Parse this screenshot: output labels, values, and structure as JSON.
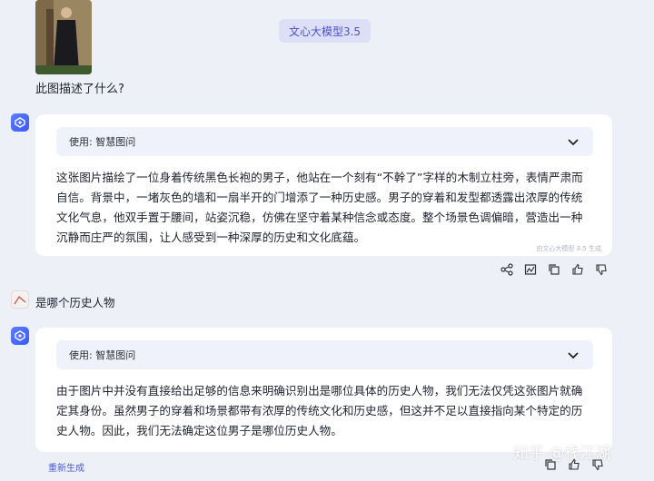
{
  "header": {
    "model_badge": "文心大模型3.5"
  },
  "conversation": {
    "q1": "此图描述了什么?",
    "a1": {
      "tool_label": "使用: 智慧图问",
      "text": "这张图片描绘了一位身着传统黑色长袍的男子，他站在一个刻有“不幹了”字样的木制立柱旁，表情严肃而自信。背景中，一堵灰色的墙和一扇半开的门增添了一种历史感。男子的穿着和发型都透露出浓厚的传统文化气息，他双手置于腰间，站姿沉稳，仿佛在坚守着某种信念或态度。整个场景色调偏暗，营造出一种沉静而庄严的氛围，让人感受到一种深厚的历史和文化底蕴。",
      "gen_note": "由文心大模型 3.5 生成"
    },
    "q2": "是哪个历史人物",
    "a2": {
      "tool_label": "使用: 智慧图问",
      "text": "由于图片中并没有直接给出足够的信息来明确识别出是哪位具体的历史人物，我们无法仅凭这张图片就确定其身份。虽然男子的穿着和场景都带有浓厚的传统文化和历史感，但这并不足以直接指向某个特定的历史人物。因此，我们无法确定这位男子是哪位历史人物。"
    }
  },
  "footer": {
    "regenerate": "重新生成",
    "watermark": "知乎 @栈江湖"
  },
  "icons": [
    "share-icon",
    "chart-icon",
    "copy-icon",
    "thumbs-up-icon",
    "thumbs-down-icon",
    "chevron-down-icon"
  ],
  "colors": {
    "accent": "#4b52c8",
    "background": "#eef0f7",
    "card": "#ffffff"
  }
}
